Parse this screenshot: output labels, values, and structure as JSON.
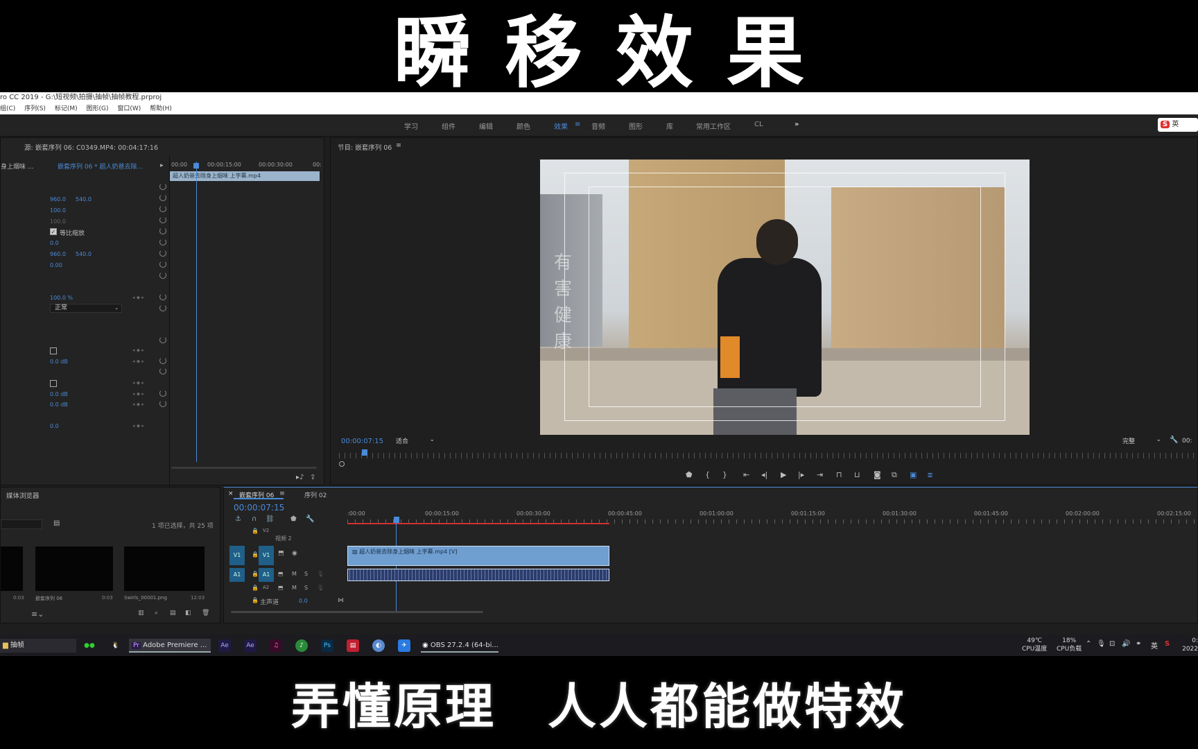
{
  "captions": {
    "top": "瞬移效果",
    "bottom": "弄懂原理　人人都能做特效"
  },
  "window": {
    "title": "ro CC 2019 - G:\\短视频\\拍摄\\抽帧\\抽帧教程.prproj"
  },
  "menu": [
    "组(C)",
    "序列(S)",
    "标记(M)",
    "图形(G)",
    "窗口(W)",
    "帮助(H)"
  ],
  "workspaces": [
    {
      "label": "学习",
      "active": false
    },
    {
      "label": "组件",
      "active": false
    },
    {
      "label": "编辑",
      "active": false
    },
    {
      "label": "颜色",
      "active": false
    },
    {
      "label": "效果",
      "active": true
    },
    {
      "label": "音频",
      "active": false
    },
    {
      "label": "图形",
      "active": false
    },
    {
      "label": "库",
      "active": false
    },
    {
      "label": "常用工作区",
      "active": false
    },
    {
      "label": "CL",
      "active": false
    }
  ],
  "ime": {
    "label": "英"
  },
  "effect_controls": {
    "source_header": "源: 嵌套序列 06: C0349.MP4: 00:04:17:16",
    "master_clip": "身上烟味 ...",
    "sequence_clip": "嵌套序列 06 * 超人奶爸去除...",
    "ruler": [
      "00:00",
      "00:00:15:00",
      "00:00:30:00",
      "00:"
    ],
    "clip_bar": "超人奶爸去除身上烟味 上字幕.mp4",
    "values": {
      "position_x": "960.0",
      "position_y": "540.0",
      "scale": "100.0",
      "scale_width": "100.0",
      "uniform_scale_label": "等比缩放",
      "rotation": "0.0",
      "anchor_x": "960.0",
      "anchor_y": "540.0",
      "anti_flicker": "0.00",
      "opacity": "100.0 %",
      "blend_mode": "正常",
      "vol1": "0.0 dB",
      "vol2": "0.0 dB",
      "vol3": "0.0 dB",
      "panner": "0.0"
    }
  },
  "program": {
    "header": "节目: 嵌套序列 06",
    "timecode": "00:00:07:15",
    "fit": "适合",
    "quality": "完整",
    "right_time": "00:",
    "overlay_chars": [
      "有",
      "害",
      "健",
      "康"
    ]
  },
  "media_browser": {
    "title": "媒体浏览器",
    "selection": "1 项已选择，共 25 项",
    "thumbs": [
      "0:03",
      "嵌套序列 06",
      "0:03",
      "Swirls_00001.png",
      "12:03"
    ]
  },
  "timeline": {
    "tabs": [
      "嵌套序列 06",
      "序列 02"
    ],
    "timecode": "00:00:07:15",
    "ruler": [
      ":00:00",
      "00:00:15:00",
      "00:00:30:00",
      "00:00:45:00",
      "00:01:00:00",
      "00:01:15:00",
      "00:01:30:00",
      "00:01:45:00",
      "00:02:00:00",
      "00:02:15:00"
    ],
    "tracks": {
      "v2": "V2",
      "v2_name": "视频 2",
      "v1": "V1",
      "a1": "A1",
      "a2": "A2",
      "master": "主声道",
      "master_val": "0.0"
    },
    "clip_name": "超人奶爸去除身上烟味 上字幕.mp4 [V]"
  },
  "taskbar": {
    "folder": "抽帧",
    "premiere": "Adobe Premiere ...",
    "obs": "OBS 27.2.4 (64-bi...",
    "cpu_temp_value": "49℃",
    "cpu_temp_label": "CPU温度",
    "cpu_load_value": "18%",
    "cpu_load_label": "CPU负载",
    "lang": "英",
    "clock_top": "0:",
    "clock_bottom": "2022"
  }
}
